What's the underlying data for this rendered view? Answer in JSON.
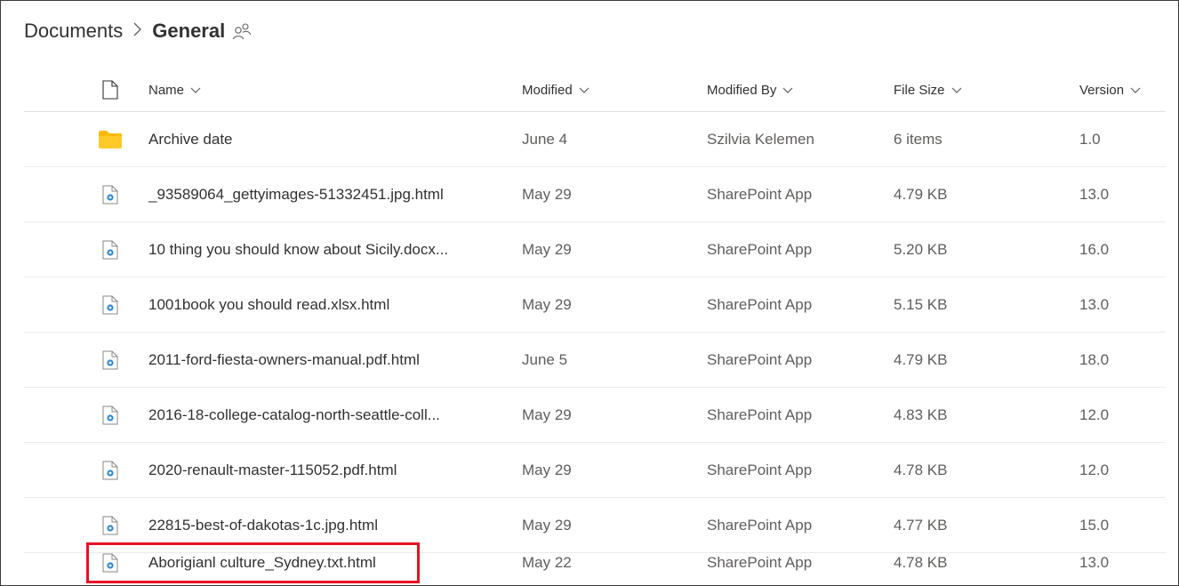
{
  "breadcrumb": {
    "root": "Documents",
    "current": "General"
  },
  "columns": {
    "name": "Name",
    "modified": "Modified",
    "modified_by": "Modified By",
    "file_size": "File Size",
    "version": "Version"
  },
  "rows": [
    {
      "type": "folder",
      "name": "Archive date",
      "modified": "June 4",
      "modified_by": "Szilvia Kelemen",
      "file_size": "6 items",
      "version": "1.0"
    },
    {
      "type": "file",
      "name": "_93589064_gettyimages-51332451.jpg.html",
      "modified": "May 29",
      "modified_by": "SharePoint App",
      "file_size": "4.79 KB",
      "version": "13.0"
    },
    {
      "type": "file",
      "name": "10 thing you should know about Sicily.docx...",
      "modified": "May 29",
      "modified_by": "SharePoint App",
      "file_size": "5.20 KB",
      "version": "16.0"
    },
    {
      "type": "file",
      "name": "1001book you should read.xlsx.html",
      "modified": "May 29",
      "modified_by": "SharePoint App",
      "file_size": "5.15 KB",
      "version": "13.0"
    },
    {
      "type": "file",
      "name": "2011-ford-fiesta-owners-manual.pdf.html",
      "modified": "June 5",
      "modified_by": "SharePoint App",
      "file_size": "4.79 KB",
      "version": "18.0"
    },
    {
      "type": "file",
      "name": "2016-18-college-catalog-north-seattle-coll...",
      "modified": "May 29",
      "modified_by": "SharePoint App",
      "file_size": "4.83 KB",
      "version": "12.0"
    },
    {
      "type": "file",
      "name": "2020-renault-master-115052.pdf.html",
      "modified": "May 29",
      "modified_by": "SharePoint App",
      "file_size": "4.78 KB",
      "version": "12.0"
    },
    {
      "type": "file",
      "name": "22815-best-of-dakotas-1c.jpg.html",
      "modified": "May 29",
      "modified_by": "SharePoint App",
      "file_size": "4.77 KB",
      "version": "15.0"
    },
    {
      "type": "file",
      "name": "Aborigianl culture_Sydney.txt.html",
      "modified": "May 22",
      "modified_by": "SharePoint App",
      "file_size": "4.78 KB",
      "version": "13.0"
    }
  ],
  "icons": {
    "breadcrumb_separator": "chevron-right-icon",
    "share": "people-icon",
    "header_file": "document-icon",
    "sort": "chevron-down-icon",
    "folder": "folder-icon",
    "file": "html-file-icon"
  },
  "colors": {
    "folder": "#FFCA28",
    "file_accent": "#2b88d8",
    "highlight": "#e81123"
  }
}
